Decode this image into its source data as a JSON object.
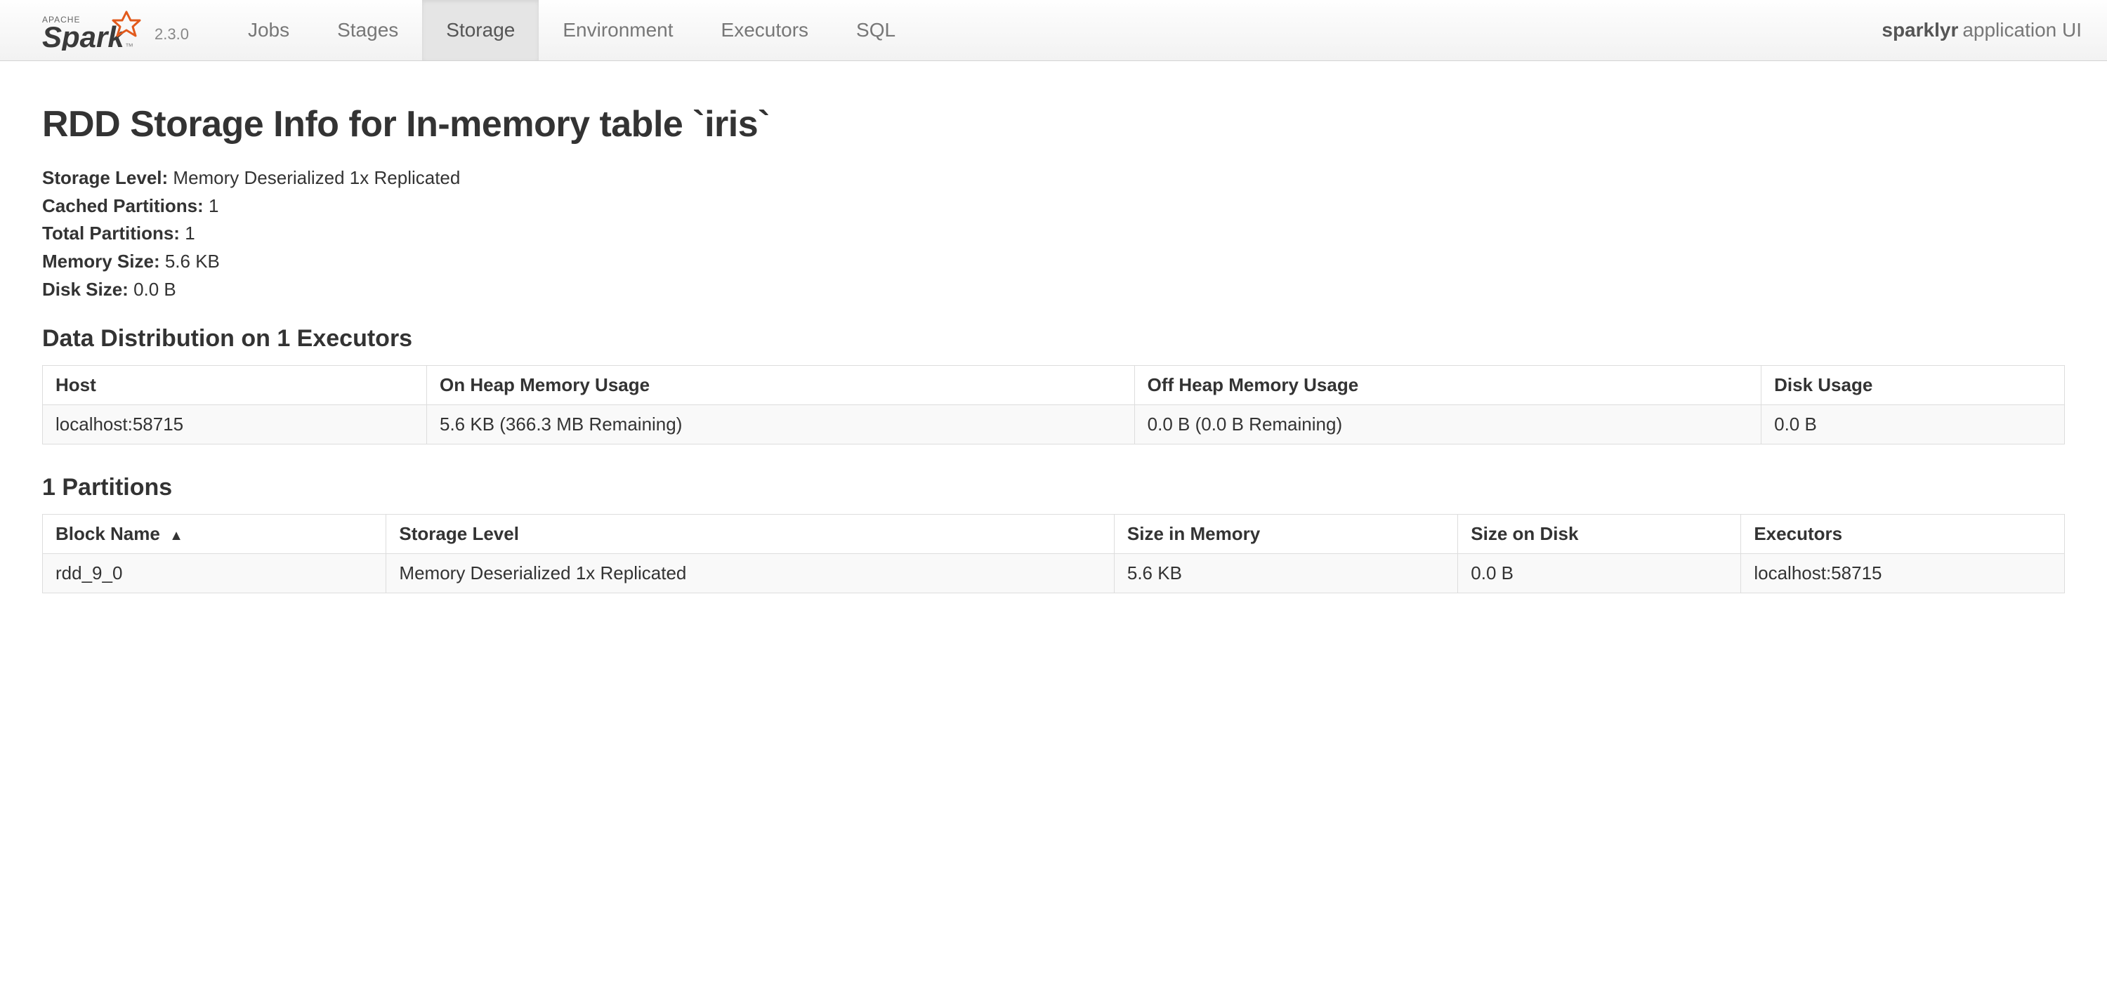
{
  "brand": {
    "version": "2.3.0"
  },
  "nav": {
    "tabs": [
      {
        "label": "Jobs",
        "active": false
      },
      {
        "label": "Stages",
        "active": false
      },
      {
        "label": "Storage",
        "active": true
      },
      {
        "label": "Environment",
        "active": false
      },
      {
        "label": "Executors",
        "active": false
      },
      {
        "label": "SQL",
        "active": false
      }
    ],
    "right": {
      "bold": "sparklyr",
      "rest": " application UI"
    }
  },
  "page": {
    "title": "RDD Storage Info for In-memory table `iris`",
    "summary": {
      "storage_level_label": "Storage Level:",
      "storage_level": "Memory Deserialized 1x Replicated",
      "cached_partitions_label": "Cached Partitions:",
      "cached_partitions": "1",
      "total_partitions_label": "Total Partitions:",
      "total_partitions": "1",
      "memory_size_label": "Memory Size:",
      "memory_size": "5.6 KB",
      "disk_size_label": "Disk Size:",
      "disk_size": "0.0 B"
    },
    "data_dist": {
      "title": "Data Distribution on 1 Executors",
      "headers": [
        "Host",
        "On Heap Memory Usage",
        "Off Heap Memory Usage",
        "Disk Usage"
      ],
      "rows": [
        {
          "host": "localhost:58715",
          "on_heap": "5.6 KB (366.3 MB Remaining)",
          "off_heap": "0.0 B (0.0 B Remaining)",
          "disk": "0.0 B"
        }
      ]
    },
    "partitions": {
      "title": "1 Partitions",
      "headers": [
        "Block Name",
        "Storage Level",
        "Size in Memory",
        "Size on Disk",
        "Executors"
      ],
      "sort_col": 0,
      "sort_arrow": "▲",
      "rows": [
        {
          "block": "rdd_9_0",
          "level": "Memory Deserialized 1x Replicated",
          "mem": "5.6 KB",
          "disk": "0.0 B",
          "exec": "localhost:58715"
        }
      ]
    }
  }
}
